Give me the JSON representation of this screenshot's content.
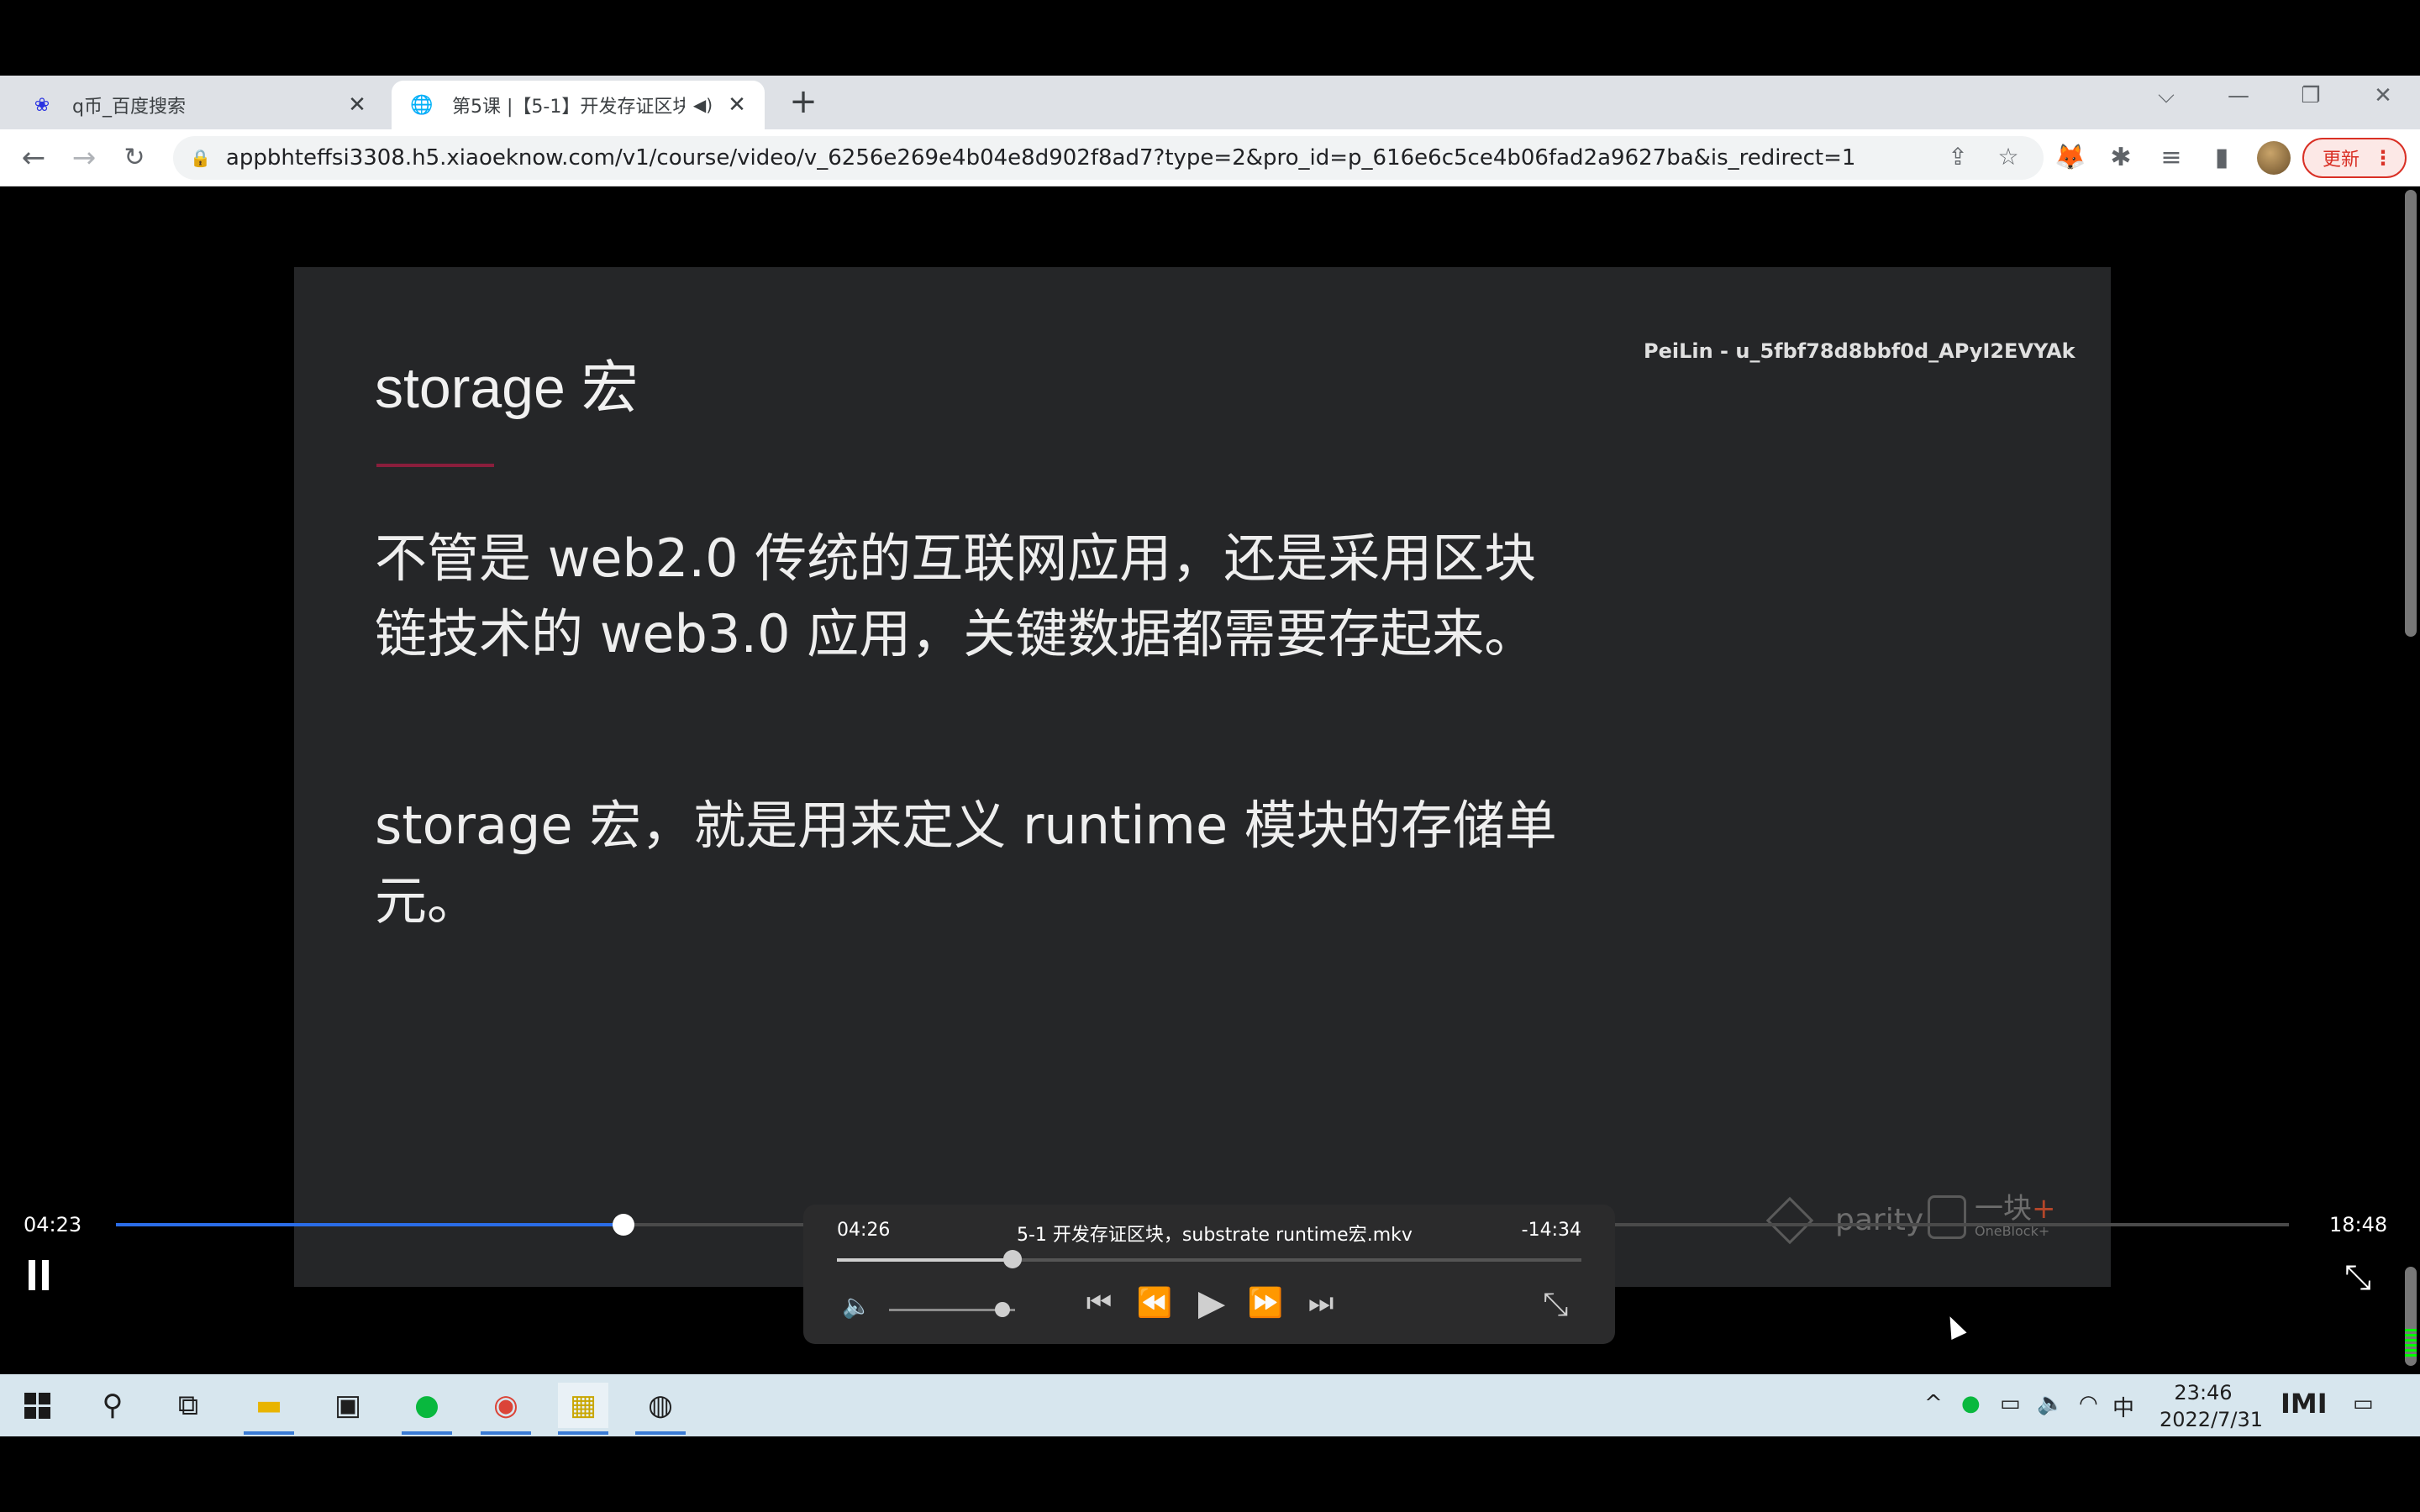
{
  "browser": {
    "tabs": [
      {
        "title": "q币_百度搜索",
        "favicon": "baidu-paw-icon",
        "active": false
      },
      {
        "title": "第5课 |【5-1】开发存证区块",
        "favicon": "globe-icon",
        "active": true,
        "muted": true
      }
    ],
    "new_tab_symbol": "+",
    "window_controls": {
      "dropdown": "⌵",
      "minimize": "—",
      "restore": "❐",
      "close": "✕"
    },
    "url": "appbhteffsi3308.h5.xiaoeknow.com/v1/course/video/v_6256e269e4b04e8d902f8ad7?type=2&pro_id=p_616e6c5ce4b06fad2a9627ba&is_redirect=1",
    "update_label": "更新",
    "extension_icons": [
      "metamask-fox-icon",
      "puzzle-extensions-icon",
      "reading-list-icon",
      "side-panel-icon"
    ]
  },
  "slide": {
    "title": "storage 宏",
    "watermark": "PeiLin - u_5fbf78d8bbf0d_APyI2EVYAk",
    "paragraph1": "不管是 web2.0 传统的互联网应用，还是采用区块链技术的 web3.0 应用，关键数据都需要存起来。",
    "paragraph2": "storage 宏，就是用来定义 runtime 模块的存储单元。",
    "brand_parity": "parity",
    "brand_oneblock_cn": "一块",
    "brand_oneblock_plus": "+",
    "brand_oneblock_en": "OneBlock+",
    "accent_color": "#8a1e3c"
  },
  "player": {
    "current_time": "04:23",
    "duration": "18:48",
    "progress": 0.2336
  },
  "mini_player": {
    "current_time": "04:26",
    "title": "5-1 开发存证区块，substrate runtime宏.mkv",
    "remaining": "-14:34",
    "progress": 0.2358,
    "volume": 0.9
  },
  "taskbar": {
    "apps": [
      "start-icon",
      "search-icon",
      "task-view-icon",
      "file-explorer-icon",
      "terminal-icon",
      "wechat-icon",
      "chrome-icon",
      "notes-app-icon",
      "obs-icon"
    ],
    "tray": {
      "chevron": "^",
      "volume": "🔈",
      "ime": "中"
    },
    "clock_time": "23:46",
    "clock_date": "2022/7/31",
    "mark": "IMI"
  }
}
